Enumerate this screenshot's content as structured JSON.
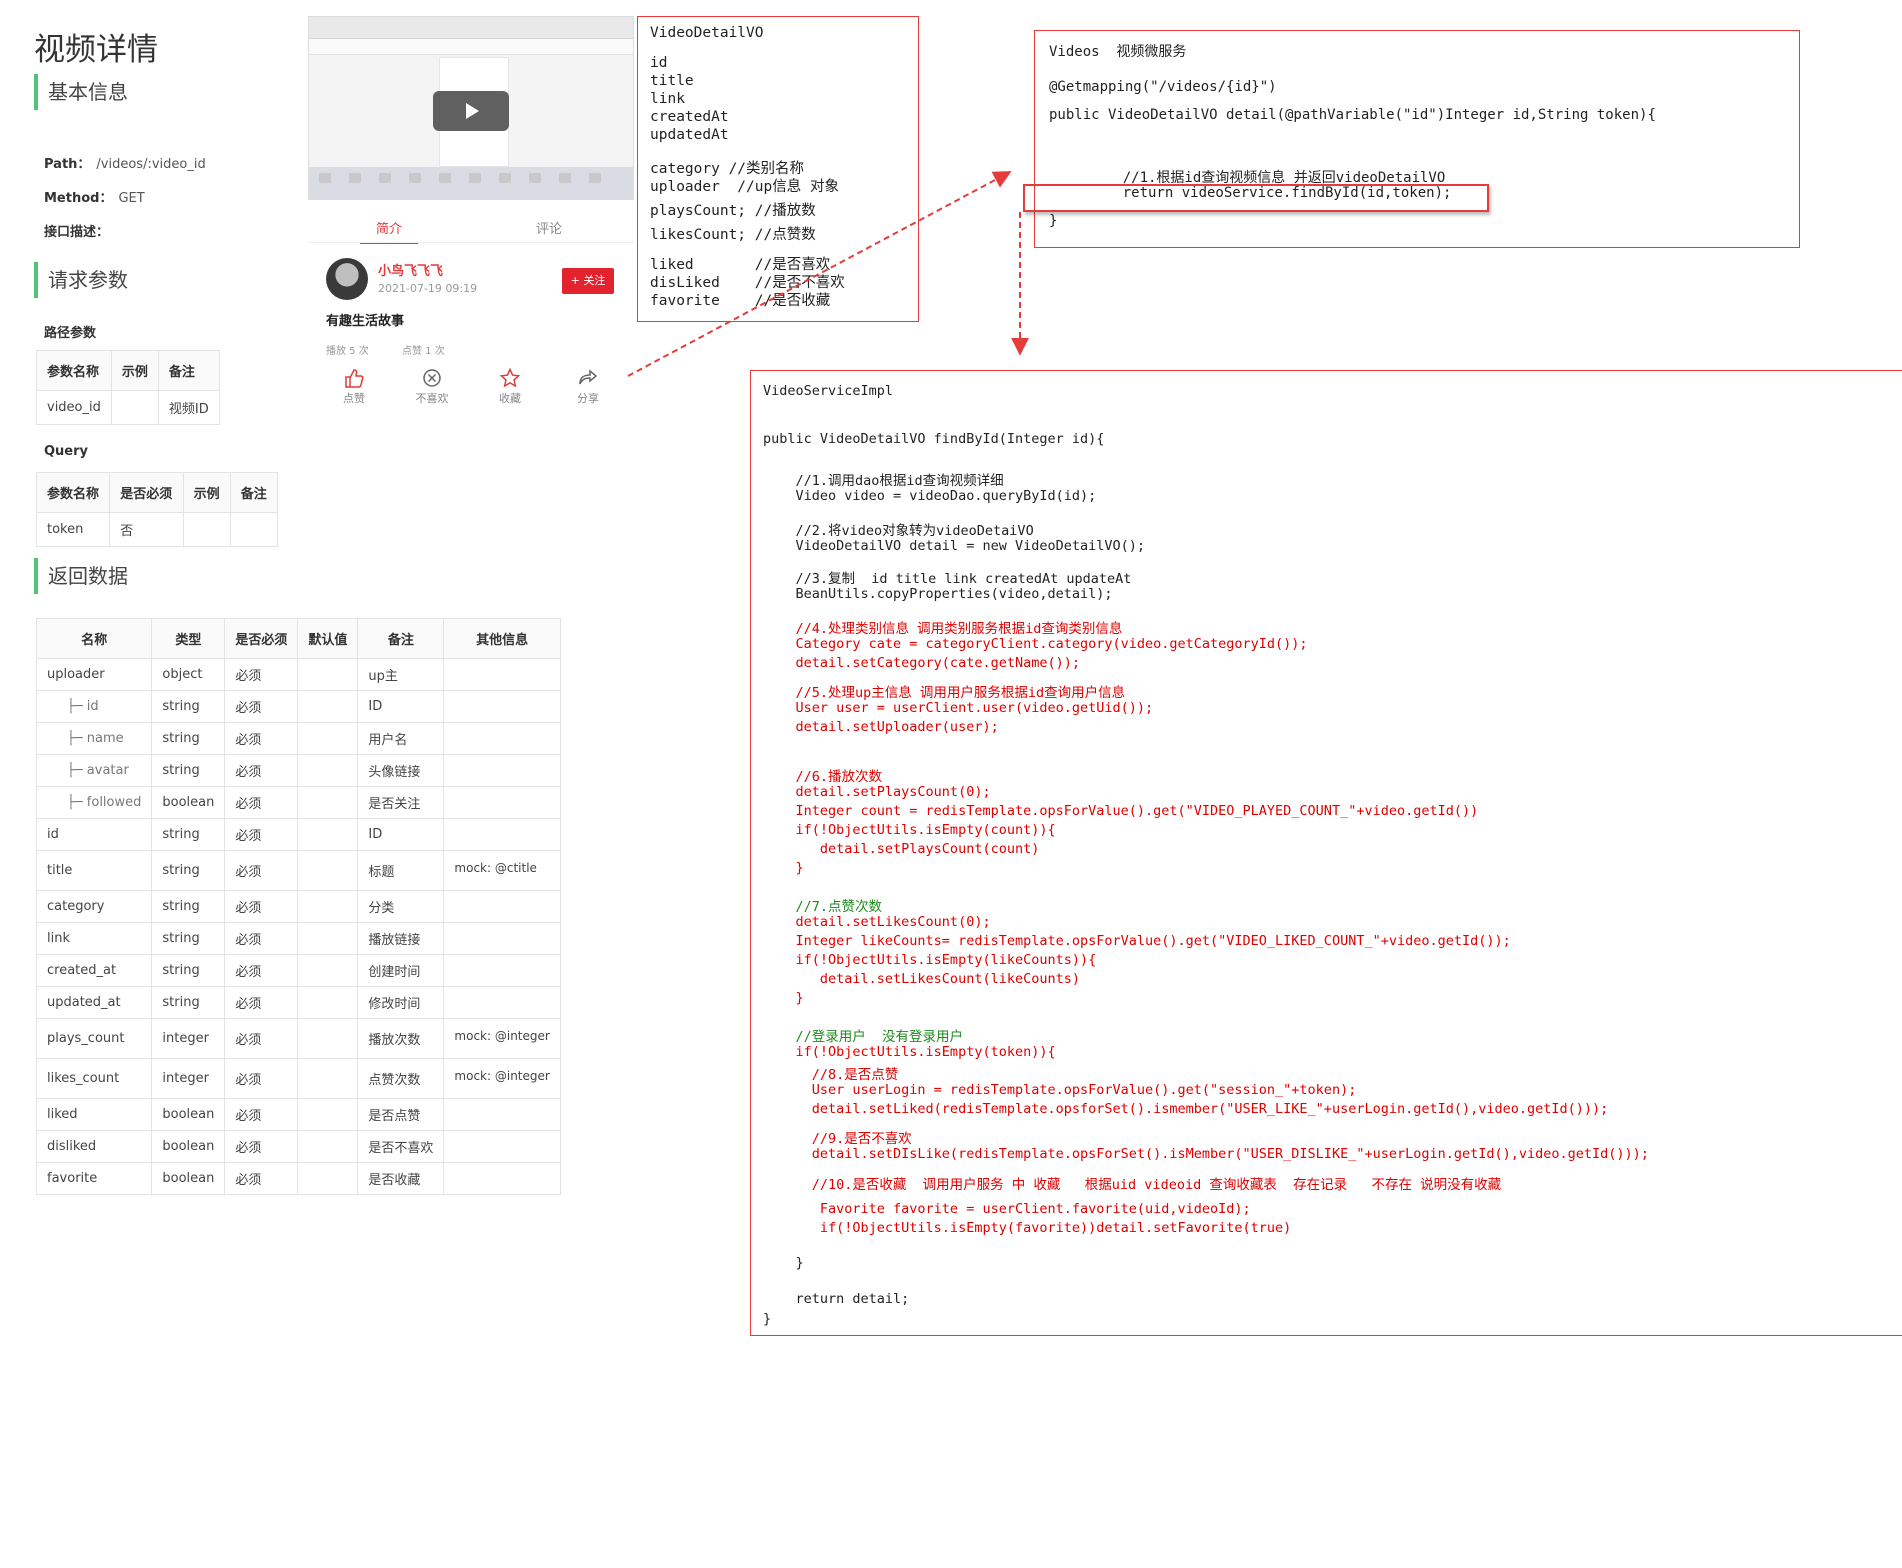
{
  "doc": {
    "title": "视频详情",
    "basic_section": "基本信息",
    "path_label": "Path：",
    "path_value": "/videos/:video_id",
    "method_label": "Method：",
    "method_value": "GET",
    "desc_label": "接口描述：",
    "request_section": "请求参数",
    "path_params_label": "路径参数",
    "path_params": {
      "headers": [
        "参数名称",
        "示例",
        "备注"
      ],
      "rows": [
        [
          "video_id",
          "",
          "视频ID"
        ]
      ]
    },
    "query_label": "Query",
    "query_params": {
      "headers": [
        "参数名称",
        "是否必须",
        "示例",
        "备注"
      ],
      "rows": [
        [
          "token",
          "否",
          "",
          ""
        ]
      ]
    },
    "return_section": "返回数据",
    "return_table": {
      "headers": [
        "名称",
        "类型",
        "是否必须",
        "默认值",
        "备注",
        "其他信息"
      ],
      "rows": [
        [
          "uploader",
          "object",
          "必须",
          "",
          "up主",
          ""
        ],
        [
          "├─ id",
          "string",
          "必须",
          "",
          "ID",
          ""
        ],
        [
          "├─ name",
          "string",
          "必须",
          "",
          "用户名",
          ""
        ],
        [
          "├─ avatar",
          "string",
          "必须",
          "",
          "头像链接",
          ""
        ],
        [
          "├─ followed",
          "boolean",
          "必须",
          "",
          "是否关注",
          ""
        ],
        [
          "id",
          "string",
          "必须",
          "",
          "ID",
          ""
        ],
        [
          "title",
          "string",
          "必须",
          "",
          "标题",
          "mock: @ctitle"
        ],
        [
          "category",
          "string",
          "必须",
          "",
          "分类",
          ""
        ],
        [
          "link",
          "string",
          "必须",
          "",
          "播放链接",
          ""
        ],
        [
          "created_at",
          "string",
          "必须",
          "",
          "创建时间",
          ""
        ],
        [
          "updated_at",
          "string",
          "必须",
          "",
          "修改时间",
          ""
        ],
        [
          "plays_count",
          "integer",
          "必须",
          "",
          "播放次数",
          "mock: @integer"
        ],
        [
          "likes_count",
          "integer",
          "必须",
          "",
          "点赞次数",
          "mock: @integer"
        ],
        [
          "liked",
          "boolean",
          "必须",
          "",
          "是否点赞",
          ""
        ],
        [
          "disliked",
          "boolean",
          "必须",
          "",
          "是否不喜欢",
          ""
        ],
        [
          "favorite",
          "boolean",
          "必须",
          "",
          "是否收藏",
          ""
        ]
      ]
    }
  },
  "phone": {
    "tabs": [
      "简介",
      "评论"
    ],
    "user_name": "小鸟飞飞飞",
    "date": "2021-07-19 09:19",
    "follow_label": "+ 关注",
    "video_title": "有趣生活故事",
    "plays": "播放 5 次",
    "likes": "点赞 1 次",
    "actions": [
      {
        "label": "点赞",
        "icon": "thumbs-up-icon"
      },
      {
        "label": "不喜欢",
        "icon": "circle-x-icon"
      },
      {
        "label": "收藏",
        "icon": "star-icon"
      },
      {
        "label": "分享",
        "icon": "share-icon"
      }
    ]
  },
  "vo_box": {
    "lines": [
      "VideoDetailVO",
      "",
      "id",
      "title",
      "link",
      "createdAt",
      "updatedAt",
      "category //类别名称",
      "uploader  //up信息 对象",
      "playsCount; //播放数",
      "likesCount; //点赞数",
      "liked       //是否喜欢",
      "disLiked    //是否不喜欢",
      "favorite    //是否收藏"
    ]
  },
  "controller_box": {
    "lines": [
      "Videos  视频微服务",
      "@Getmapping(\"/videos/{id}\")",
      "public VideoDetailVO detail(@pathVariable(\"id\")Integer id,String token){",
      "    //1.根据id查询视频信息 并返回videoDetailVO",
      "    return videoService.findById(id,token);",
      "}"
    ]
  },
  "impl_box": {
    "lines": [
      {
        "t": "VideoServiceImpl",
        "c": ""
      },
      {
        "t": "public VideoDetailVO findById(Integer id){",
        "c": ""
      },
      {
        "t": "    //1.调用dao根据id查询视频详细",
        "c": ""
      },
      {
        "t": "    Video video = videoDao.queryById(id);",
        "c": ""
      },
      {
        "t": "    //2.将video对象转为videoDetaiVO",
        "c": ""
      },
      {
        "t": "    VideoDetailVO detail = new VideoDetailVO();",
        "c": ""
      },
      {
        "t": "    //3.复制  id title link createdAt updateAt",
        "c": ""
      },
      {
        "t": "    BeanUtils.copyProperties(video,detail);",
        "c": ""
      },
      {
        "t": "    //4.处理类别信息 调用类别服务根据id查询类别信息",
        "c": "red"
      },
      {
        "t": "    Category cate = categoryClient.category(video.getCategoryId());",
        "c": "red"
      },
      {
        "t": "    detail.setCategory(cate.getName());",
        "c": "red"
      },
      {
        "t": "    //5.处理up主信息 调用用户服务根据id查询用户信息",
        "c": "red"
      },
      {
        "t": "    User user = userClient.user(video.getUid());",
        "c": "red"
      },
      {
        "t": "    detail.setUploader(user);",
        "c": "red"
      },
      {
        "t": "    //6.播放次数",
        "c": "red"
      },
      {
        "t": "    detail.setPlaysCount(0);",
        "c": "red"
      },
      {
        "t": "    Integer count = redisTemplate.opsForValue().get(\"VIDEO_PLAYED_COUNT_\"+video.getId())",
        "c": "red"
      },
      {
        "t": "    if(!ObjectUtils.isEmpty(count)){",
        "c": "red"
      },
      {
        "t": "       detail.setPlaysCount(count)",
        "c": "red"
      },
      {
        "t": "    }",
        "c": "red"
      },
      {
        "t": "    //7.点赞次数",
        "c": "green"
      },
      {
        "t": "    detail.setLikesCount(0);",
        "c": "red"
      },
      {
        "t": "    Integer likeCounts= redisTemplate.opsForValue().get(\"VIDEO_LIKED_COUNT_\"+video.getId());",
        "c": "red"
      },
      {
        "t": "    if(!ObjectUtils.isEmpty(likeCounts)){",
        "c": "red"
      },
      {
        "t": "       detail.setLikesCount(likeCounts)",
        "c": "red"
      },
      {
        "t": "    }",
        "c": "red"
      },
      {
        "t": "    //登录用户  没有登录用户",
        "c": "green"
      },
      {
        "t": "    if(!ObjectUtils.isEmpty(token)){",
        "c": "red"
      },
      {
        "t": "      //8.是否点赞",
        "c": "red"
      },
      {
        "t": "      User userLogin = redisTemplate.opsForValue().get(\"session_\"+token);",
        "c": "red"
      },
      {
        "t": "      detail.setLiked(redisTemplate.opsforSet().ismember(\"USER_LIKE_\"+userLogin.getId(),video.getId()));",
        "c": "red"
      },
      {
        "t": "      //9.是否不喜欢",
        "c": "red"
      },
      {
        "t": "      detail.setDIsLike(redisTemplate.opsForSet().isMember(\"USER_DISLIKE_\"+userLogin.getId(),video.getId()));",
        "c": "red"
      },
      {
        "t": "      //10.是否收藏  调用用户服务 中 收藏   根据uid videoid 查询收藏表  存在记录   不存在 说明没有收藏",
        "c": "red"
      },
      {
        "t": "       Favorite favorite = userClient.favorite(uid,videoId);",
        "c": "red"
      },
      {
        "t": "       if(!ObjectUtils.isEmpty(favorite))detail.setFavorite(true)",
        "c": "red"
      },
      {
        "t": "    }",
        "c": ""
      },
      {
        "t": "    return detail;",
        "c": ""
      },
      {
        "t": "}",
        "c": ""
      }
    ]
  },
  "colors": {
    "accent_green": "#52c47a",
    "box_border": "#e53b3b",
    "code_red": "#e00000",
    "code_green": "#1e8a1e"
  }
}
